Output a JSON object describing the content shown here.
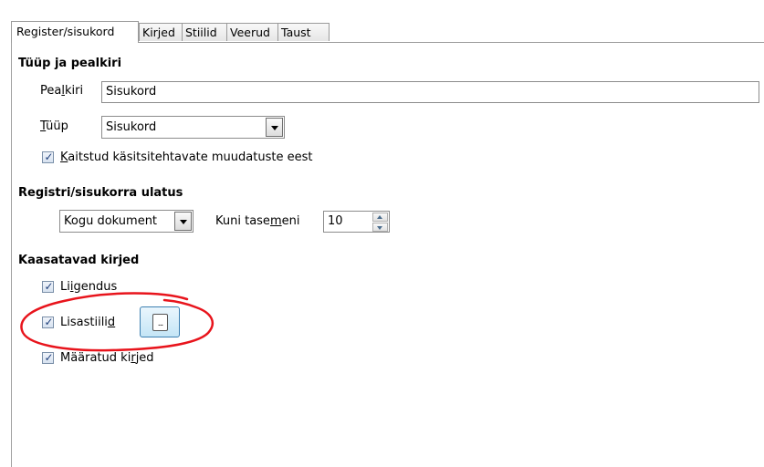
{
  "tabs": [
    {
      "label": "Register/sisukord",
      "active": true
    },
    {
      "label": "Kirjed",
      "active": false
    },
    {
      "label": "Stiilid",
      "active": false
    },
    {
      "label": "Veerud",
      "active": false
    },
    {
      "label": "Taust",
      "active": false
    }
  ],
  "type_title": {
    "heading": "Tüüp ja pealkiri",
    "title_label_pre": "Pea",
    "title_label_ul": "l",
    "title_label_post": "kiri",
    "title_value": "Sisukord",
    "type_label_ul": "T",
    "type_label_post": "üüp",
    "type_value": "Sisukord",
    "protect_label_ul": "K",
    "protect_label_post": "aitstud käsitsitehtavate muudatuste eest",
    "protect_checked": true
  },
  "scope": {
    "heading": "Registri/sisukorra ulatus",
    "scope_value": "Kogu dokument",
    "level_label_pre": "Kuni tase",
    "level_label_ul": "m",
    "level_label_post": "eni",
    "level_value": "10"
  },
  "create_from": {
    "heading": "Kaasatavad kirjed",
    "outline_pre": "Li",
    "outline_ul": "i",
    "outline_post": "gendus",
    "outline_checked": true,
    "styles_pre": "Lisastiili",
    "styles_ul": "d",
    "styles_post": "",
    "styles_checked": true,
    "styles_button": "...",
    "marks_pre": "Määratud ki",
    "marks_ul": "r",
    "marks_post": "jed",
    "marks_checked": true
  },
  "check_glyph": "✓",
  "colors": {
    "annotation": "#e8141c",
    "button_border": "#3c7fb1"
  }
}
